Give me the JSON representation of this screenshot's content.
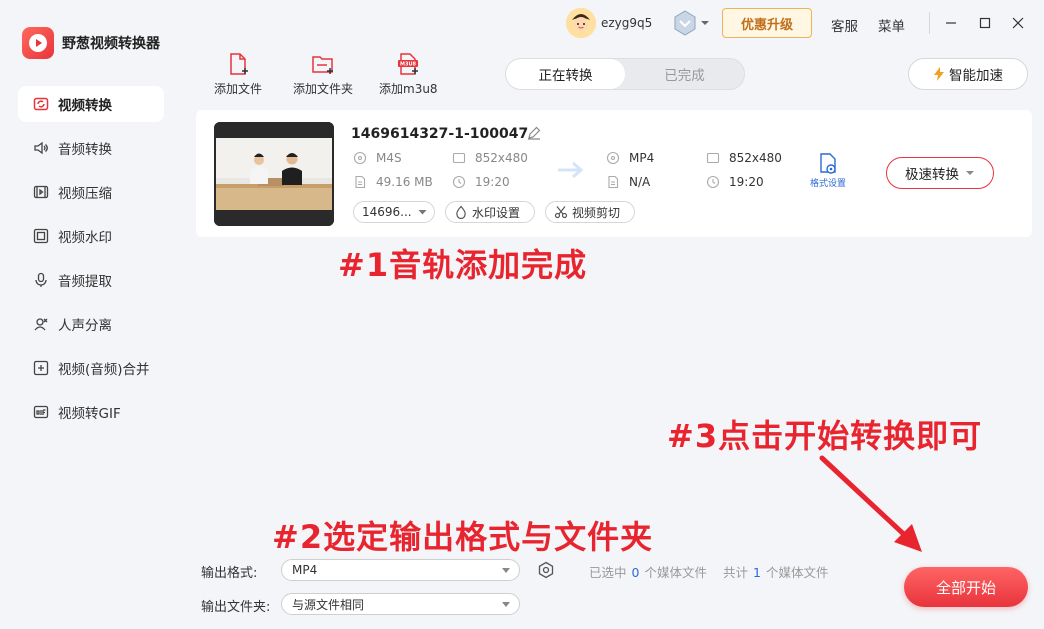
{
  "app": {
    "name": "野葱视频转换器"
  },
  "sidebar": {
    "items": [
      {
        "label": "视频转换",
        "icon": "video-convert-icon",
        "active": true
      },
      {
        "label": "音频转换",
        "icon": "audio-convert-icon"
      },
      {
        "label": "视频压缩",
        "icon": "video-compress-icon"
      },
      {
        "label": "视频水印",
        "icon": "video-watermark-icon"
      },
      {
        "label": "音频提取",
        "icon": "audio-extract-icon"
      },
      {
        "label": "人声分离",
        "icon": "voice-separate-icon"
      },
      {
        "label": "视频(音频)合并",
        "icon": "merge-icon"
      },
      {
        "label": "视频转GIF",
        "icon": "gif-icon"
      }
    ]
  },
  "header": {
    "username": "ezyg9q5",
    "upgrade_label": "优惠升级",
    "service_label": "客服",
    "menu_label": "菜单"
  },
  "toolbar": {
    "add_file": "添加文件",
    "add_folder": "添加文件夹",
    "add_m3u8": "添加m3u8",
    "m3u8_badge": "M3U8",
    "tabs": [
      "正在转换",
      "已完成"
    ],
    "boost_label": "智能加速"
  },
  "file": {
    "name": "1469614327-1-100047",
    "input": {
      "format": "M4S",
      "resolution": "852x480",
      "size": "49.16 MB",
      "duration": "19:20"
    },
    "output": {
      "format": "MP4",
      "resolution": "852x480",
      "size": "N/A",
      "duration": "19:20"
    },
    "format_settings_label": "格式设置",
    "convert_label": "极速转换",
    "track_select": "14696...",
    "watermark_label": "水印设置",
    "cut_label": "视频剪切"
  },
  "annotations": {
    "a1": "#1音轨添加完成",
    "a2": "#2选定输出格式与文件夹",
    "a3": "#3点击开始转换即可"
  },
  "bottom": {
    "format_label": "输出格式:",
    "format_value": "MP4",
    "folder_label": "输出文件夹:",
    "folder_value": "与源文件相同",
    "selected_prefix": "已选中",
    "selected_count": "0",
    "selected_suffix": "个媒体文件",
    "total_prefix": "共计",
    "total_count": "1",
    "total_suffix": "个媒体文件",
    "start_label": "全部开始"
  },
  "colors": {
    "accent": "#e8343c",
    "link": "#2b6ad6",
    "annotation": "#e8252e"
  }
}
